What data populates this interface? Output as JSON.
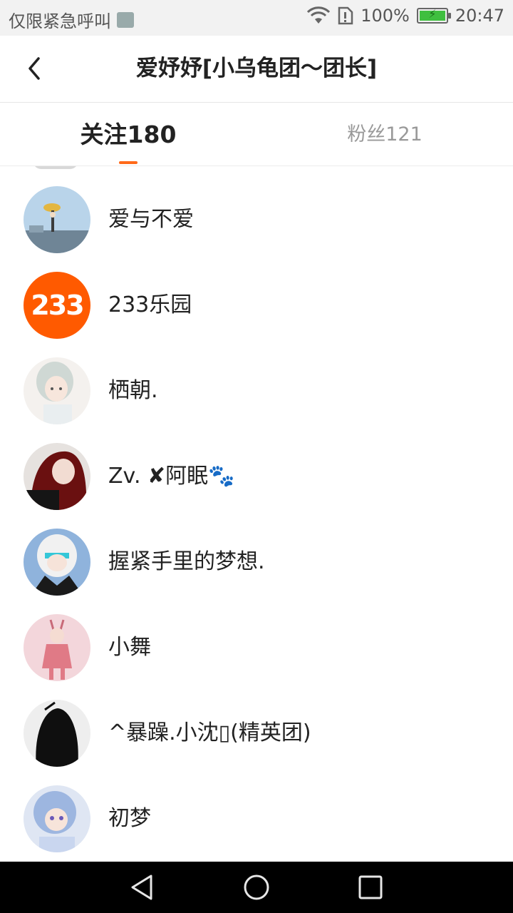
{
  "status_bar": {
    "carrier": "仅限紧急呼叫",
    "battery": "100%",
    "time": "20:47"
  },
  "header": {
    "title": "爱妤妤[小乌龟团～团长]"
  },
  "tabs": [
    {
      "label": "关注180"
    },
    {
      "label": "粉丝121"
    }
  ],
  "follow_list": [
    {
      "name": "爱与不爱"
    },
    {
      "name": "233乐园",
      "avatar_text": "233"
    },
    {
      "name": "栖朝."
    },
    {
      "name": "Zv. ✘阿眠🐾"
    },
    {
      "name": "握紧手里的梦想."
    },
    {
      "name": "小舞"
    },
    {
      "name": "^暴躁.小沈▯(精英团)"
    },
    {
      "name": "初梦"
    }
  ],
  "colors": {
    "accent": "#ff6a1a",
    "avatar_233": "#ff5a00"
  }
}
